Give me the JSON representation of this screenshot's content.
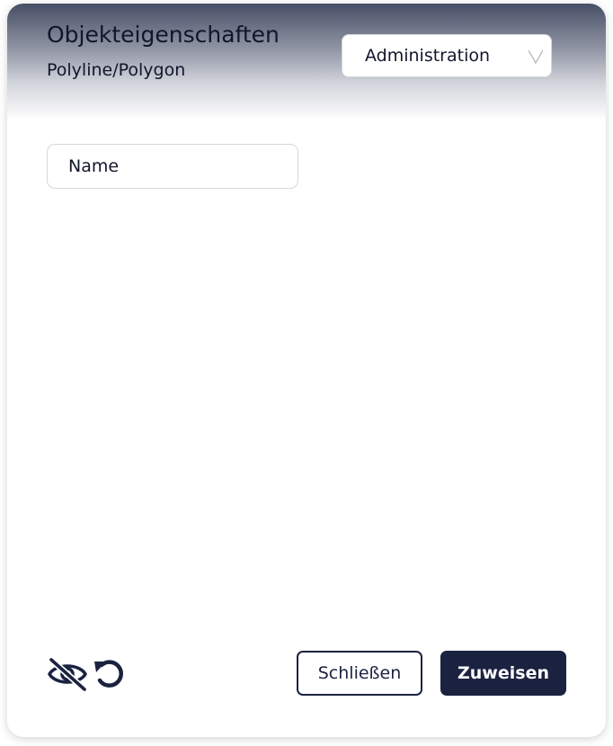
{
  "dialog": {
    "title": "Objekteigenschaften",
    "subtitle": "Polyline/Polygon"
  },
  "role_select": {
    "value": "Administration",
    "icon": "chevron-down-icon"
  },
  "name_field": {
    "placeholder": "Name",
    "value": ""
  },
  "footer": {
    "hide_icon": "eye-off-icon",
    "reset_icon": "undo-icon",
    "close_label": "Schließen",
    "assign_label": "Zuweisen"
  },
  "colors": {
    "primary": "#1b2240",
    "header_dark": "#474e65",
    "text": "#11162a",
    "border": "#d7d8dc"
  }
}
